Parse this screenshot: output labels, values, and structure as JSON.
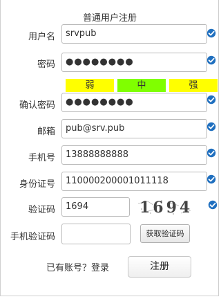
{
  "form": {
    "title": "普通用户注册",
    "fields": {
      "username": {
        "label": "用户名",
        "value": "srvpub"
      },
      "password": {
        "label": "密码",
        "value": "●●●●●●●●"
      },
      "confirm_password": {
        "label": "确认密码",
        "value": "●●●●●●●●"
      },
      "email": {
        "label": "邮箱",
        "value": "pub@srv.pub"
      },
      "phone": {
        "label": "手机号",
        "value": "13888888888"
      },
      "id_number": {
        "label": "身份证号",
        "value": "110000200001011118"
      },
      "captcha": {
        "label": "验证码",
        "value": "1694"
      },
      "sms_code": {
        "label": "手机验证码",
        "value": ""
      }
    },
    "password_strength": {
      "weak": "弱",
      "medium": "中",
      "strong": "强",
      "colors": {
        "weak": "#ffff00",
        "medium": "#80ff00",
        "strong": "#ffff00"
      }
    },
    "captcha_image": {
      "text": "1694"
    },
    "sms_button_label": "获取验证码",
    "login_prompt": "已有账号？登录",
    "register_button_label": "注册",
    "valid_icon": "check-circle-icon",
    "valid_color": "#1f6fbf"
  }
}
